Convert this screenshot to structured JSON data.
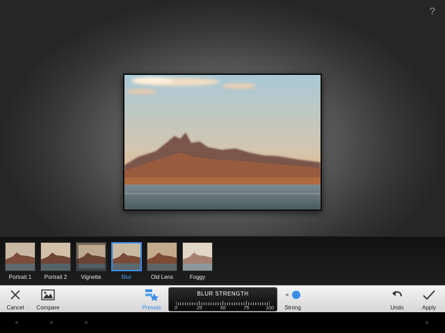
{
  "help_label": "?",
  "presets": [
    {
      "label": "Portrait 1",
      "selected": false
    },
    {
      "label": "Portrait 2",
      "selected": false
    },
    {
      "label": "Vignette",
      "selected": false
    },
    {
      "label": "Blur",
      "selected": true
    },
    {
      "label": "Old Lens",
      "selected": false
    },
    {
      "label": "Foggy",
      "selected": false
    }
  ],
  "toolbar": {
    "cancel_label": "Cancel",
    "compare_label": "Compare",
    "presets_label": "Presets",
    "strength_label": "Strong",
    "undo_label": "Undo",
    "apply_label": "Apply"
  },
  "slider": {
    "title": "BLUR STRENGTH",
    "tick_labels": [
      "0",
      "25",
      "50",
      "75",
      "100"
    ],
    "value": 100
  },
  "colors": {
    "accent": "#3a8ee8",
    "toolbar_bg": "#e4e4e4",
    "strip_bg": "#181818"
  }
}
